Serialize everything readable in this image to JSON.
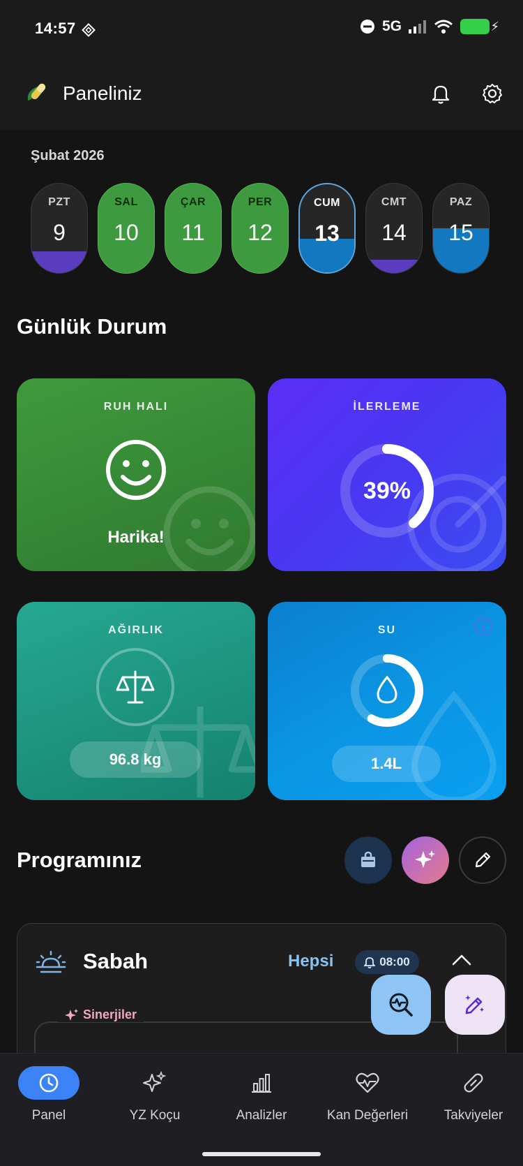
{
  "status_bar": {
    "time": "14:57",
    "network": "5G"
  },
  "app_bar": {
    "title": "Paneliniz"
  },
  "calendar": {
    "month": "Şubat 2026",
    "days": [
      {
        "label": "PZT",
        "number": "9",
        "fill_color": "#5b3dbf",
        "fill_fraction": 0.24
      },
      {
        "label": "SAL",
        "number": "10",
        "fill_color": "#3d9a3f",
        "fill_fraction": 1.0
      },
      {
        "label": "ÇAR",
        "number": "11",
        "fill_color": "#3d9a3f",
        "fill_fraction": 1.0
      },
      {
        "label": "PER",
        "number": "12",
        "fill_color": "#3d9a3f",
        "fill_fraction": 1.0
      },
      {
        "label": "CUM",
        "number": "13",
        "fill_color": "#1278c0",
        "fill_fraction": 0.38
      },
      {
        "label": "CMT",
        "number": "14",
        "fill_color": "#5b3dbf",
        "fill_fraction": 0.15
      },
      {
        "label": "PAZ",
        "number": "15",
        "fill_color": "#1278c0",
        "fill_fraction": 0.5
      }
    ]
  },
  "daily_status": {
    "title": "Günlük Durum",
    "mood": {
      "title": "RUH HALI",
      "value": "Harika!",
      "color": "#3c8e3a"
    },
    "progress": {
      "title": "İLERLEME",
      "value": "39%",
      "percent": 39,
      "color": "#4a2cf0"
    },
    "weight": {
      "title": "AĞIRLIK",
      "value": "96.8 kg",
      "color": "#1a9a88"
    },
    "water": {
      "title": "SU",
      "value": "1.4L",
      "fill_fraction": 0.58,
      "color": "#0a93e0"
    }
  },
  "program": {
    "title": "Programınız",
    "period": {
      "name": "Sabah",
      "filter": "Hepsi",
      "time": "08:00"
    },
    "synergy_label": "Sinerjiler"
  },
  "bottom_nav": {
    "items": [
      {
        "label": "Panel",
        "icon": "clock-icon",
        "active": true
      },
      {
        "label": "YZ Koçu",
        "icon": "sparkles-icon",
        "active": false
      },
      {
        "label": "Analizler",
        "icon": "bar-chart-icon",
        "active": false
      },
      {
        "label": "Kan Değerleri",
        "icon": "heart-pulse-icon",
        "active": false
      },
      {
        "label": "Takviyeler",
        "icon": "pill-icon",
        "active": false
      }
    ]
  },
  "colors": {
    "accent": "#3b82f6",
    "background": "#141414"
  }
}
